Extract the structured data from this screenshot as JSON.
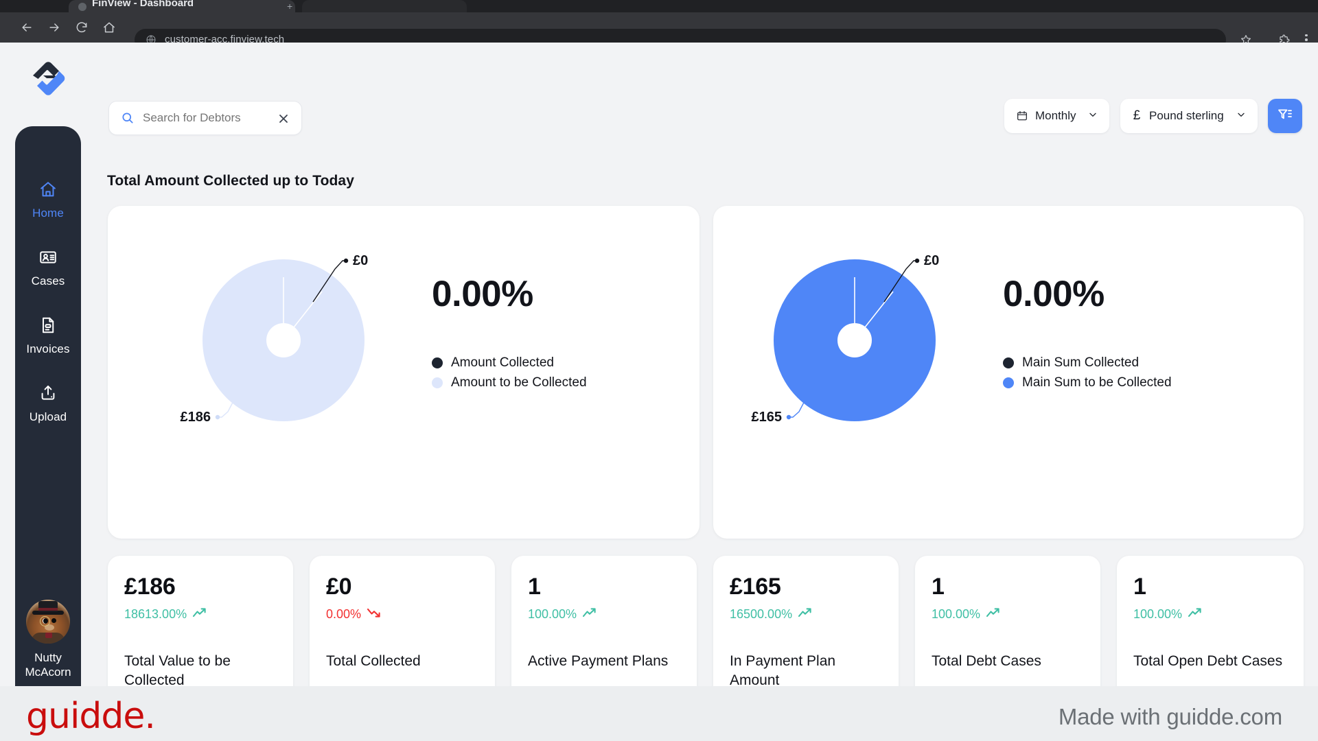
{
  "browser": {
    "tab_title": "FinView - Dashboard",
    "url": "customer-acc.finview.tech",
    "back_icon": "back-arrow-icon",
    "forward_icon": "forward-arrow-icon",
    "reload_icon": "reload-icon",
    "home_icon": "home-icon",
    "site_icon": "globe-icon",
    "bookmark_icon": "star-icon",
    "extensions_icon": "puzzle-icon",
    "menu_icon": "three-dot-menu-icon",
    "new_tab_label": "+"
  },
  "sidebar": {
    "logo_name": "finview-logo",
    "items": [
      {
        "label": "Home",
        "icon": "house-icon",
        "active": true
      },
      {
        "label": "Cases",
        "icon": "id-card-icon",
        "active": false
      },
      {
        "label": "Invoices",
        "icon": "document-icon",
        "active": false
      },
      {
        "label": "Upload",
        "icon": "upload-icon",
        "active": false
      }
    ],
    "user": {
      "name_line1": "Nutty",
      "name_line2": "McAcorn",
      "avatar_alt": "squirrel-top-hat-avatar"
    }
  },
  "topbar": {
    "search_placeholder": "Search for Debtors",
    "search_value": "",
    "search_icon": "magnifier-icon",
    "clear_icon": "close-icon",
    "period": {
      "label": "Monthly",
      "icon": "calendar-icon",
      "chevron": "chevron-down-icon"
    },
    "currency": {
      "label": "Pound sterling",
      "symbol": "£",
      "chevron": "chevron-down-icon"
    },
    "filter_button_icon": "filter-icon"
  },
  "main": {
    "section_title": "Total Amount Collected up to Today"
  },
  "chart_data": [
    {
      "type": "pie",
      "name": "total-amount-collected-donut",
      "title": "",
      "categories": [
        "Amount Collected",
        "Amount to be Collected"
      ],
      "values": [
        0,
        186
      ],
      "labels": [
        "£0",
        "£186"
      ],
      "colors": [
        "#1d2430",
        "#dde6fb"
      ],
      "percentage": "0.00%",
      "legend_position": "right",
      "currency": "£"
    },
    {
      "type": "pie",
      "name": "main-sum-collected-donut",
      "title": "",
      "categories": [
        "Main Sum Collected",
        "Main Sum to be Collected"
      ],
      "values": [
        0,
        165
      ],
      "labels": [
        "£0",
        "£165"
      ],
      "colors": [
        "#1d2430",
        "#4f86f7"
      ],
      "percentage": "0.00%",
      "legend_position": "right",
      "currency": "£"
    }
  ],
  "kpis": [
    {
      "value": "£186",
      "delta": "18613.00%",
      "trend": "up",
      "label": "Total Value to be Collected"
    },
    {
      "value": "£0",
      "delta": "0.00%",
      "trend": "down",
      "label": "Total Collected"
    },
    {
      "value": "1",
      "delta": "100.00%",
      "trend": "up",
      "label": "Active Payment Plans"
    },
    {
      "value": "£165",
      "delta": "16500.00%",
      "trend": "up",
      "label": "In Payment Plan Amount"
    },
    {
      "value": "1",
      "delta": "100.00%",
      "trend": "up",
      "label": "Total Debt Cases"
    },
    {
      "value": "1",
      "delta": "100.00%",
      "trend": "up",
      "label": "Total Open Debt Cases"
    }
  ],
  "footer": {
    "logo_text": "guidde.",
    "made_with": "Made with guidde.com"
  },
  "colors": {
    "accent_blue": "#4f86f7",
    "light_blue": "#dde6fb",
    "dark_navy": "#242b38",
    "trend_up": "#3fbfa4",
    "trend_down": "#f23030",
    "guidde_red": "#c90d0d"
  }
}
